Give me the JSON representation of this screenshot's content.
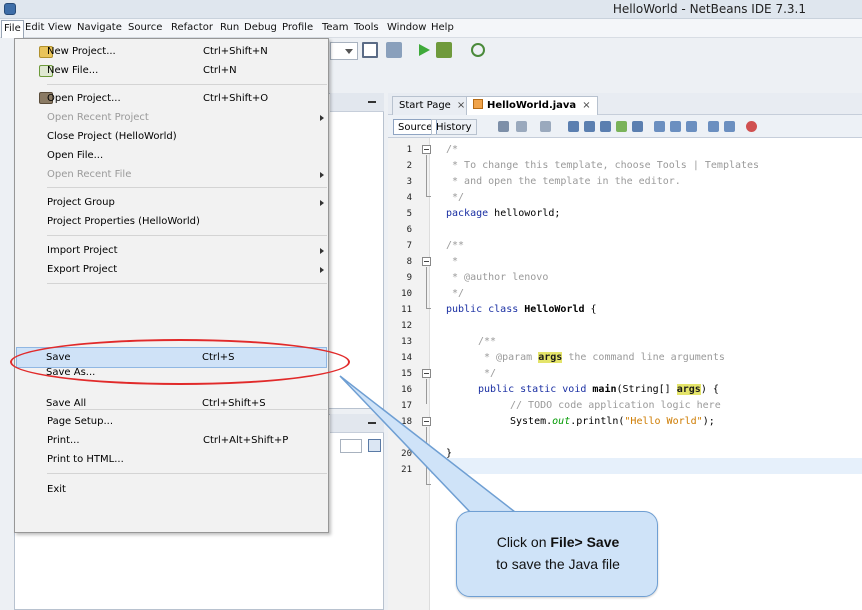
{
  "window": {
    "title": "HelloWorld - NetBeans IDE 7.3.1"
  },
  "menubar": [
    "File",
    "Edit",
    "View",
    "Navigate",
    "Source",
    "Refactor",
    "Run",
    "Debug",
    "Profile",
    "Team",
    "Tools",
    "Window",
    "Help"
  ],
  "file_menu": {
    "new_project": {
      "label": "New Project...",
      "shortcut": "Ctrl+Shift+N"
    },
    "new_file": {
      "label": "New File...",
      "shortcut": "Ctrl+N"
    },
    "open_project": {
      "label": "Open Project...",
      "shortcut": "Ctrl+Shift+O"
    },
    "open_recent_project": {
      "label": "Open Recent Project"
    },
    "close_project": {
      "label": "Close Project (HelloWorld)"
    },
    "open_file": {
      "label": "Open File..."
    },
    "open_recent_file": {
      "label": "Open Recent File"
    },
    "project_group": {
      "label": "Project Group"
    },
    "project_properties": {
      "label": "Project Properties (HelloWorld)"
    },
    "import_project": {
      "label": "Import Project"
    },
    "export_project": {
      "label": "Export Project"
    },
    "save": {
      "label": "Save",
      "shortcut": "Ctrl+S"
    },
    "save_as": {
      "label": "Save As..."
    },
    "save_all": {
      "label": "Save All",
      "shortcut": "Ctrl+Shift+S"
    },
    "page_setup": {
      "label": "Page Setup..."
    },
    "print": {
      "label": "Print...",
      "shortcut": "Ctrl+Alt+Shift+P"
    },
    "print_html": {
      "label": "Print to HTML..."
    },
    "exit": {
      "label": "Exit"
    }
  },
  "editor": {
    "tabs": [
      {
        "label": "Start Page"
      },
      {
        "label": "HelloWorld.java"
      }
    ],
    "close_glyph": "×",
    "view_source": "Source",
    "view_history": "History",
    "line_numbers": [
      "1",
      "2",
      "3",
      "4",
      "5",
      "6",
      "7",
      "8",
      "9",
      "10",
      "11",
      "12",
      "13",
      "14",
      "15",
      "16",
      "17",
      "18",
      "19",
      "20",
      "21"
    ],
    "code": {
      "l1": "/*",
      "l2": " * To change this template, choose Tools | Templates",
      "l3": " * and open the template in the editor.",
      "l4": " */",
      "l5a": "package",
      "l5b": " helloworld;",
      "l7": "/**",
      "l8": " *",
      "l9": " * @author lenovo",
      "l10": " */",
      "l11a": "public class",
      "l11b": "HelloWorld",
      "l11c": " {",
      "l13": "/**",
      "l14a": " * @param ",
      "l14b": "args",
      "l14c": " the command line arguments",
      "l15": " */",
      "l16a": "public static void",
      "l16b": "main",
      "l16c": "(String[] ",
      "l16d": "args",
      "l16e": ") {",
      "l17": "// TODO code application logic here",
      "l18a": "System.",
      "l18b": "out",
      "l18c": ".println(",
      "l18d": "\"Hello World\"",
      "l18e": ");",
      "l19": "}",
      "l20": "}"
    }
  },
  "callout": {
    "line1_prefix": "Click on ",
    "line1_bold": "File> Save",
    "line2": "to save the Java file"
  },
  "colors": {
    "highlight_ring": "#e12a2a",
    "callout_fill": "#cfe3f8",
    "selection": "#cfe2f7"
  }
}
